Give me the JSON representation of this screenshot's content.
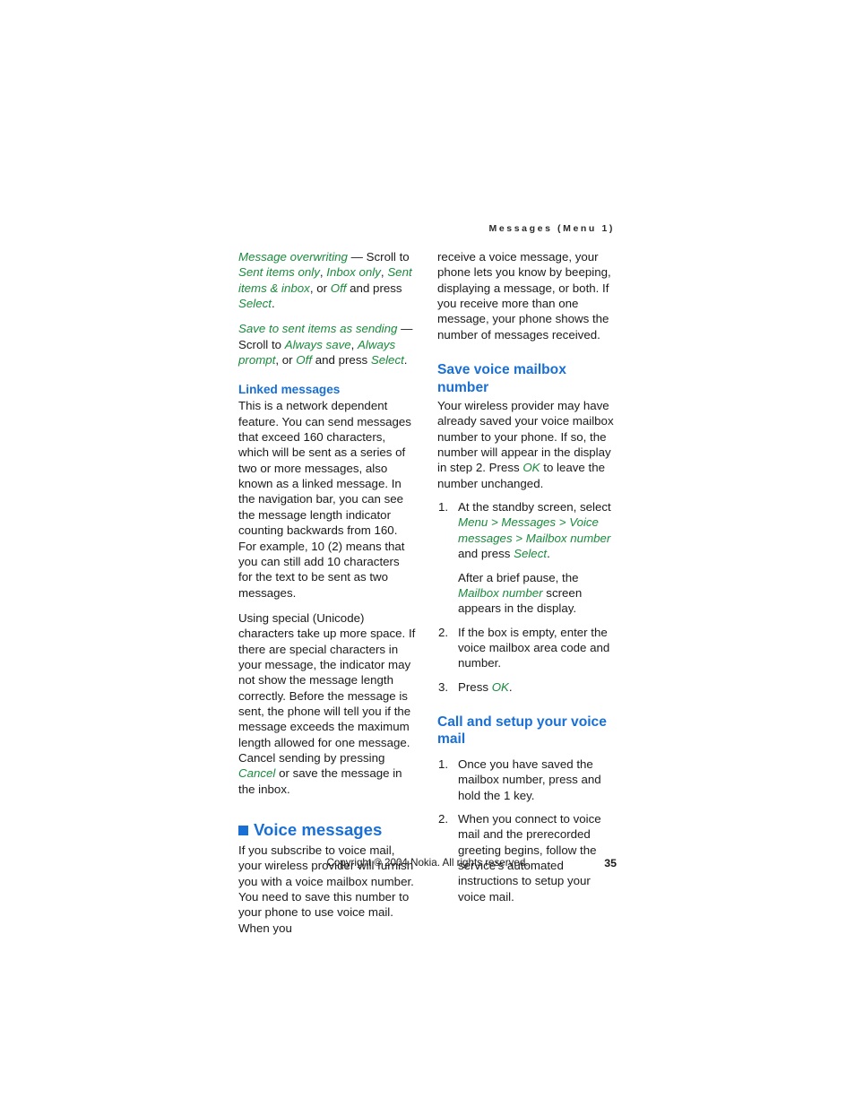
{
  "header": {
    "running_title": "Messages (Menu 1)"
  },
  "left_column": {
    "para_message_overwriting": "Message overwriting",
    "para_message_overwriting_rest_1": " — Scroll to ",
    "opt_sent_items_only": "Sent items only",
    "sep_1": ", ",
    "opt_inbox_only": "Inbox only",
    "sep_2": ", ",
    "opt_sent_items_inbox": "Sent items & inbox",
    "rest_2": ", or ",
    "opt_off": "Off",
    "rest_3": " and press ",
    "opt_select": "Select",
    "rest_4": ".",
    "para_save_to_sent": "Save to sent items as sending",
    "save_rest_1": " — Scroll to ",
    "opt_always_save": "Always save",
    "save_sep_1": ", ",
    "opt_always_prompt": "Always prompt",
    "save_rest_2": ", or ",
    "opt_off2": "Off",
    "save_rest_3": " and press ",
    "opt_select2": "Select",
    "save_rest_4": ".",
    "heading_linked_messages": "Linked messages",
    "para_linked_1": "This is a network dependent feature. You can send messages that exceed 160 characters, which will be sent as a series of two or more messages, also known as a linked message. In the navigation bar, you can see the message length indicator counting backwards from 160. For example, 10 (2) means that you can still add 10 characters for the text to be sent as two messages.",
    "para_unicode_1": "Using special (Unicode) characters take up more space. If there are special characters in your message, the indicator may not show the message length correctly. Before the message is sent, the phone will tell you if the message exceeds the maximum length allowed for one message. Cancel sending by pressing ",
    "opt_cancel": "Cancel",
    "para_unicode_2": " or save the message in the inbox.",
    "heading_voice_messages": "Voice messages",
    "para_voice_1": "If you subscribe to voice mail, your wireless provider will furnish you with a voice mailbox number. You need to save this number to your phone to use voice mail. When you"
  },
  "right_column": {
    "para_continued": "receive a voice message, your phone lets you know by beeping, displaying a message, or both. If you receive more than one message, your phone shows the number of messages received.",
    "heading_save_voice_mailbox": "Save voice mailbox number",
    "para_save_1": "Your wireless provider may have already saved your voice mailbox number to your phone. If so, the number will appear in the display in step 2. Press ",
    "opt_ok": "OK",
    "para_save_2": " to leave the number unchanged.",
    "steps_save": [
      {
        "num": "1.",
        "text_1": "At the standby screen, select ",
        "menu_1": "Menu",
        "gt_1": " > ",
        "menu_2": "Messages",
        "gt_2": " > ",
        "menu_3": "Voice messages",
        "gt_3": " > ",
        "menu_4": "Mailbox number",
        "text_2": " and press ",
        "menu_5": "Select",
        "text_3": ".",
        "sub_text_1": "After a brief pause, the ",
        "sub_menu_1": "Mailbox number",
        "sub_text_2": " screen appears in the display."
      },
      {
        "num": "2.",
        "text_1": "If the box is empty, enter the voice mailbox area code and number."
      },
      {
        "num": "3.",
        "text_1": "Press ",
        "menu_1": "OK",
        "text_2": "."
      }
    ],
    "heading_call_setup": "Call and setup your voice mail",
    "steps_call": [
      {
        "num": "1.",
        "text_1": "Once you have saved the mailbox number, press and hold the 1 key."
      },
      {
        "num": "2.",
        "text_1": "When you connect to voice mail and the prerecorded greeting begins, follow the service's automated instructions to setup your voice mail."
      }
    ]
  },
  "footer": {
    "copyright": "Copyright © 2004 Nokia. All rights reserved.",
    "page_number": "35"
  },
  "colors": {
    "heading_blue": "#1a6fd4",
    "emphasis_green": "#1a8a3c",
    "body_text": "#1a1a1a"
  }
}
